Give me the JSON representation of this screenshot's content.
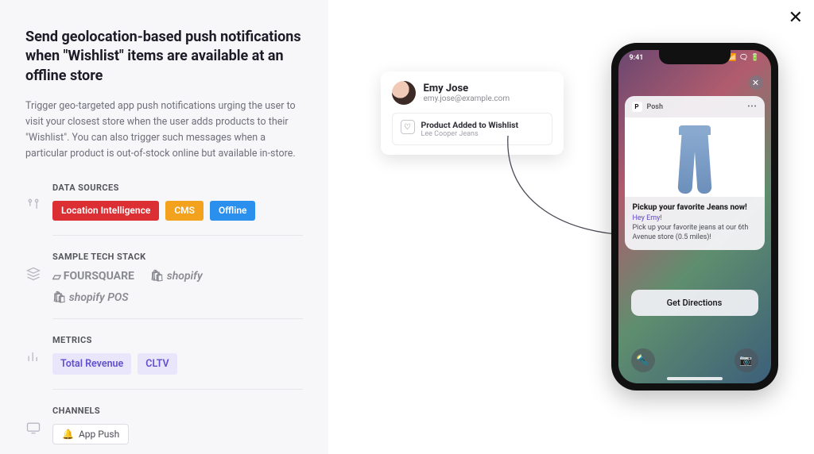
{
  "header": {
    "title": "Send geolocation-based push notifications when \"Wishlist\" items are available at an offline store",
    "description": "Trigger geo-targeted app push notifications urging the user to visit your closest store when the user adds products to their \"Wishlist\". You can also trigger such messages when a particular product is out-of-stock online but available in-store."
  },
  "sections": {
    "data_sources": {
      "label": "DATA SOURCES",
      "tags": [
        "Location Intelligence",
        "CMS",
        "Offline"
      ]
    },
    "tech_stack": {
      "label": "SAMPLE TECH STACK",
      "items": [
        "FOURSQUARE",
        "shopify",
        "shopify POS"
      ]
    },
    "metrics": {
      "label": "METRICS",
      "items": [
        "Total Revenue",
        "CLTV"
      ]
    },
    "channels": {
      "label": "CHANNELS",
      "items": [
        "App Push"
      ]
    }
  },
  "preview": {
    "user": {
      "name": "Emy Jose",
      "email": "emy.jose@example.com"
    },
    "event": {
      "title": "Product Added to Wishlist",
      "subtitle": "Lee Cooper Jeans"
    },
    "phone": {
      "time": "9:41",
      "app_name": "Posh",
      "notif_title": "Pickup your favorite Jeans now!",
      "notif_greeting": "Hey Emy!",
      "notif_text": "Pick up your favorite jeans at our 6th Avenue store (0.5 miles)!",
      "cta": "Get Directions"
    }
  },
  "close_label": "✕"
}
